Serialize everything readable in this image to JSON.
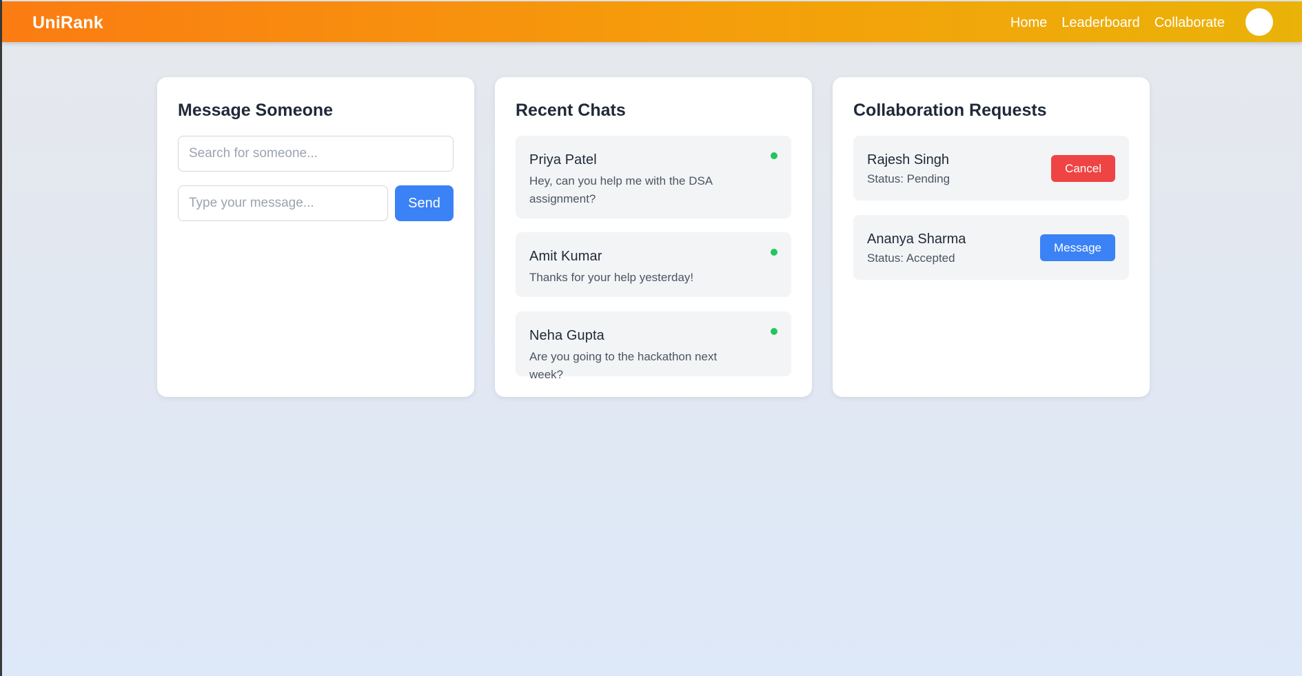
{
  "header": {
    "brand": "UniRank",
    "nav": [
      "Home",
      "Leaderboard",
      "Collaborate"
    ]
  },
  "message_someone": {
    "title": "Message Someone",
    "search_placeholder": "Search for someone...",
    "message_placeholder": "Type your message...",
    "send_label": "Send"
  },
  "recent_chats": {
    "title": "Recent Chats",
    "items": [
      {
        "name": "Priya Patel",
        "preview": "Hey, can you help me with the DSA assignment?",
        "online": true
      },
      {
        "name": "Amit Kumar",
        "preview": "Thanks for your help yesterday!",
        "online": true
      },
      {
        "name": "Neha Gupta",
        "preview": "Are you going to the hackathon next week?",
        "online": true
      }
    ]
  },
  "collaboration_requests": {
    "title": "Collaboration Requests",
    "items": [
      {
        "name": "Rajesh Singh",
        "status": "Status: Pending",
        "action": "Cancel"
      },
      {
        "name": "Ananya Sharma",
        "status": "Status: Accepted",
        "action": "Message"
      }
    ]
  },
  "colors": {
    "header_gradient_start": "#fb7c12",
    "header_gradient_end": "#eab308",
    "primary": "#3b82f6",
    "danger": "#ef4444",
    "online": "#22c55e"
  }
}
